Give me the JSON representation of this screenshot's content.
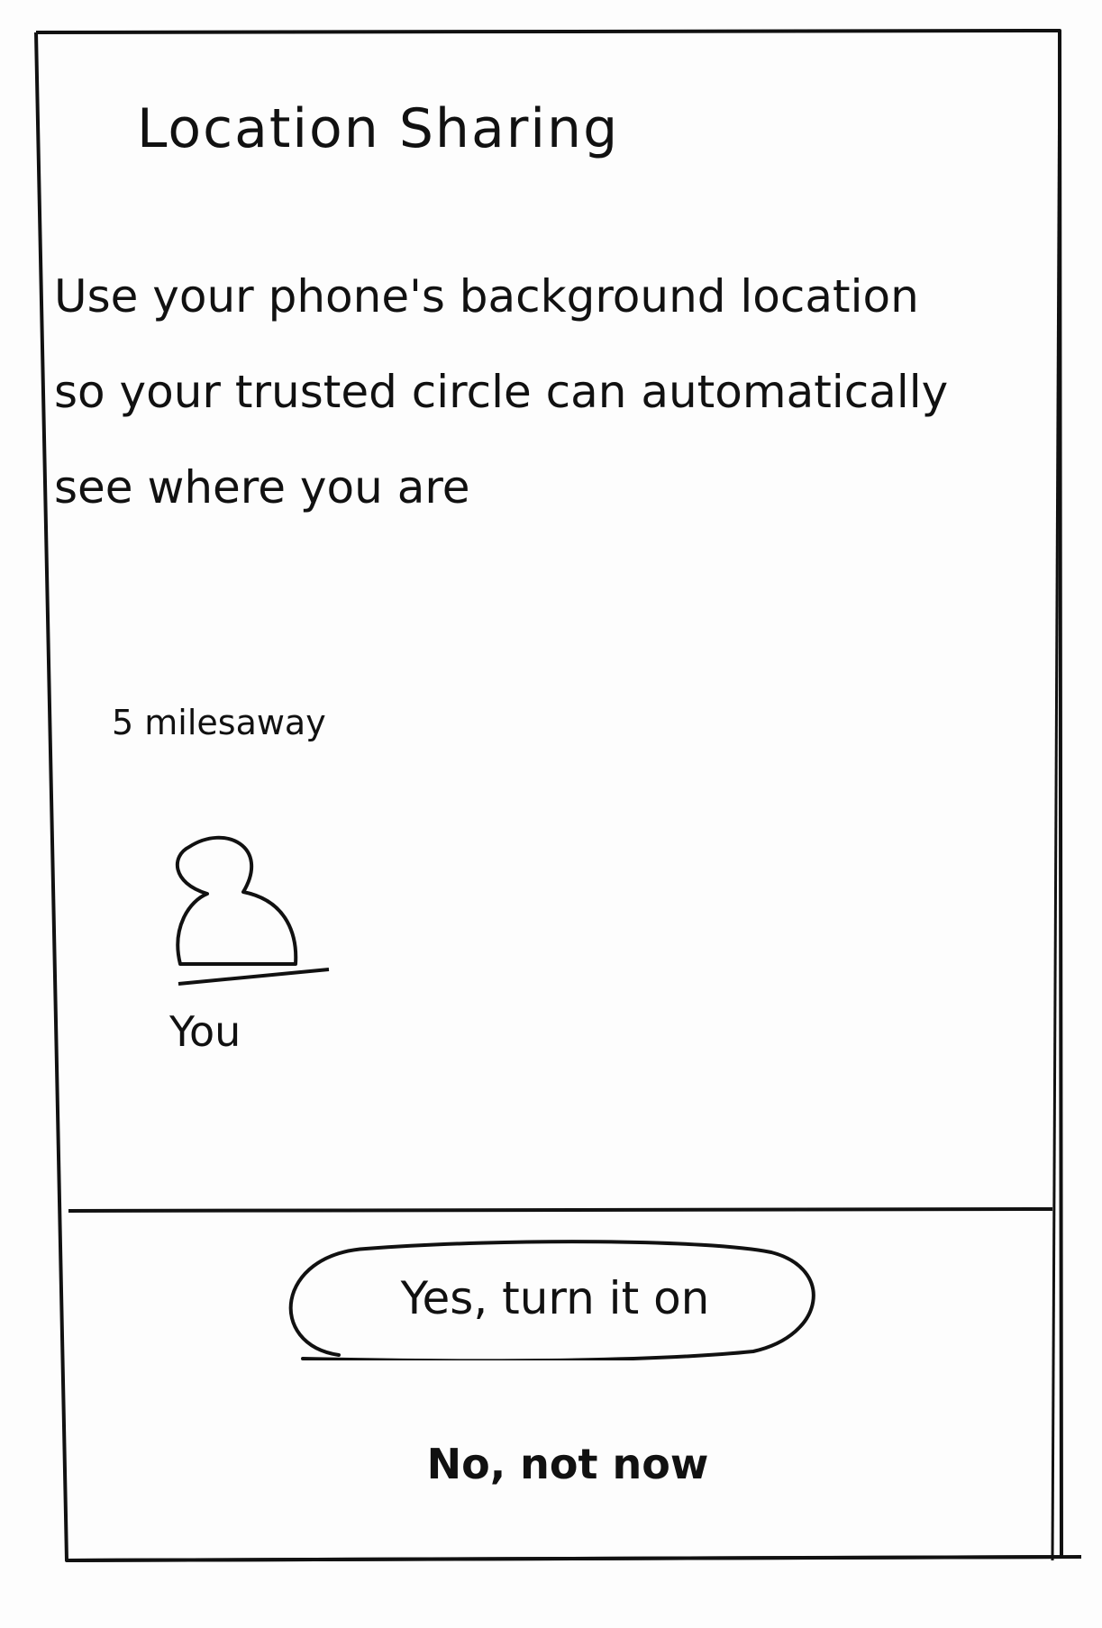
{
  "screen": {
    "title": "Location Sharing",
    "description": "Use your phone's background location so your trusted circle can automatically see where you are"
  },
  "map_preview": {
    "distance_label": "5 milesaway",
    "avatar_icon": "person-icon",
    "avatar_label": "You"
  },
  "actions": {
    "primary_label": "Yes, turn it on",
    "secondary_label": "No, not now"
  },
  "colors": {
    "ink": "#111111",
    "paper": "#fdfdfd"
  }
}
